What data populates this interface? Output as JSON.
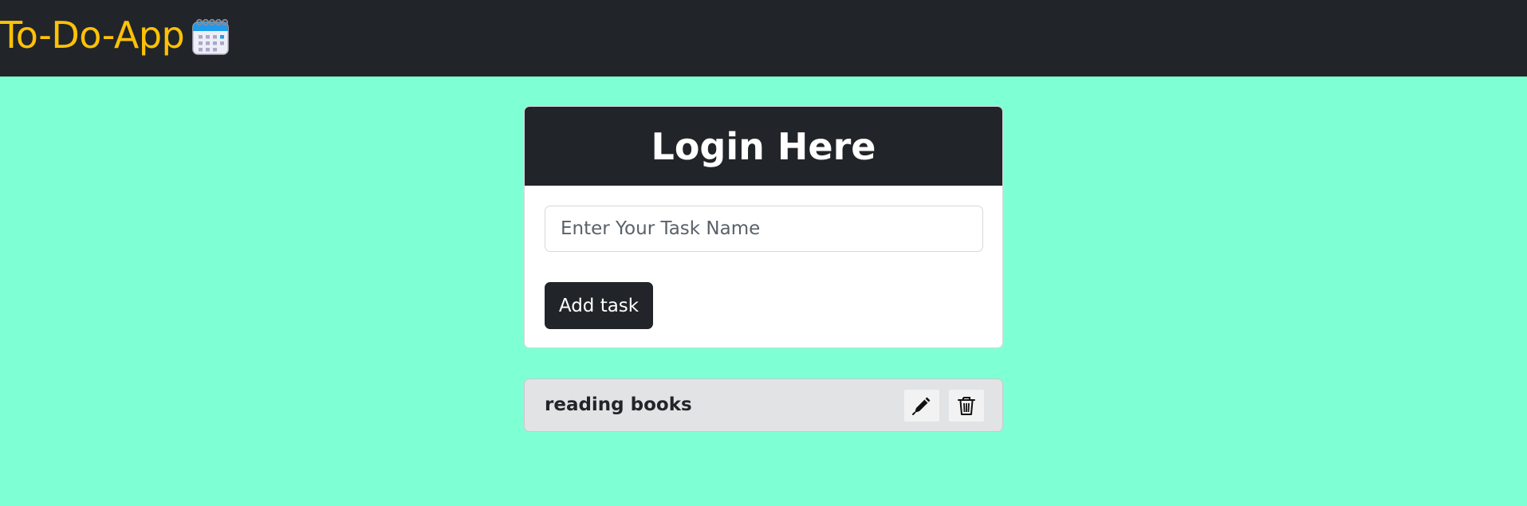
{
  "navbar": {
    "brand_text": "To-Do-App",
    "brand_icon": "calendar-icon"
  },
  "login_card": {
    "title": "Login Here",
    "task_input": {
      "placeholder": "Enter Your Task Name",
      "value": ""
    },
    "add_button_label": "Add task"
  },
  "tasks": [
    {
      "name": "reading books",
      "edit_icon": "pen-icon",
      "delete_icon": "trash-icon"
    }
  ],
  "colors": {
    "page_background": "#7fffd4",
    "navbar_background": "#212529",
    "brand": "#ffc107",
    "card_header": "#212529",
    "task_item_background": "#e2e3e5"
  }
}
